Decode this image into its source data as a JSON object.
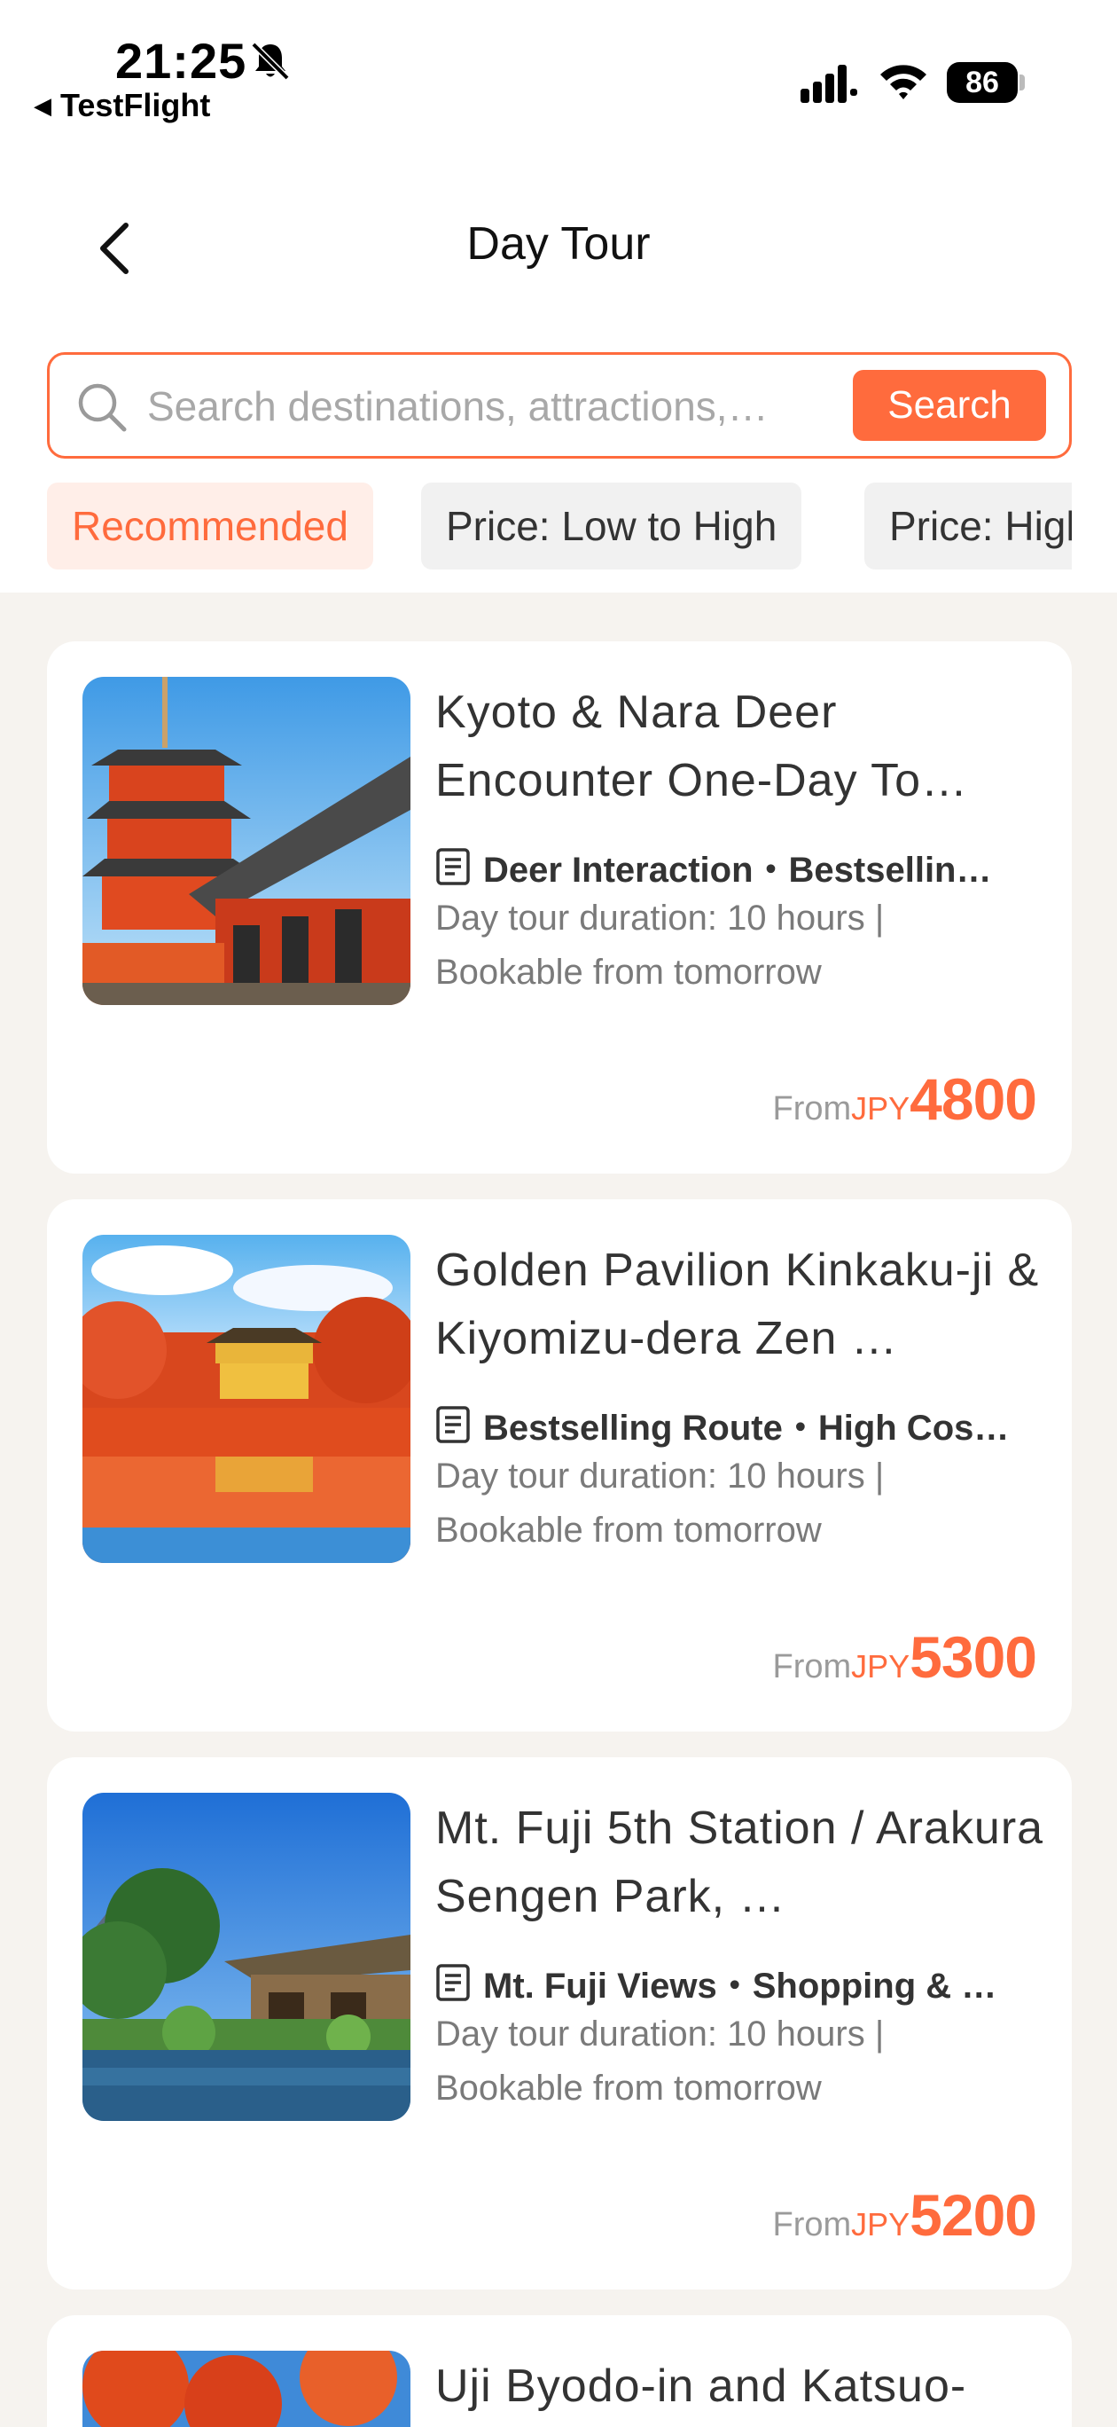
{
  "status_bar": {
    "time": "21:25",
    "back_app": "TestFlight",
    "battery": "86"
  },
  "header": {
    "title": "Day Tour"
  },
  "search": {
    "placeholder": "Search destinations, attractions,…",
    "button_label": "Search"
  },
  "sort_options": [
    {
      "label": "Recommended",
      "active": true
    },
    {
      "label": "Price: Low to High",
      "active": false
    },
    {
      "label": "Price: High to Low",
      "active": false
    }
  ],
  "tours": [
    {
      "title": "Kyoto & Nara Deer Encounter One-Day To…",
      "tags": "Deer Interaction・Bestsellin…",
      "description": "Day tour duration: 10 hours | Bookable from tomorrow",
      "price_prefix": "From",
      "currency": "JPY",
      "price": "4800"
    },
    {
      "title": "Golden Pavilion Kinkaku-ji & Kiyomizu-dera Zen …",
      "tags": "Bestselling Route・High Cos…",
      "description": "Day tour duration: 10 hours | Bookable from tomorrow",
      "price_prefix": "From",
      "currency": "JPY",
      "price": "5300"
    },
    {
      "title": " Mt. Fuji 5th Station / Arakura Sengen Park, …",
      "tags": "Mt. Fuji Views・Shopping & …",
      "description": "Day tour duration: 10 hours | Bookable from tomorrow",
      "price_prefix": "From",
      "currency": "JPY",
      "price": "5200"
    },
    {
      "title": "Uji Byodo-in and Katsuo-",
      "tags": "",
      "description": "",
      "price_prefix": "",
      "currency": "",
      "price": ""
    }
  ],
  "colors": {
    "accent": "#ff6b3d",
    "page_bg": "#f6f3ef",
    "chip_active_bg": "#ffeee8"
  }
}
